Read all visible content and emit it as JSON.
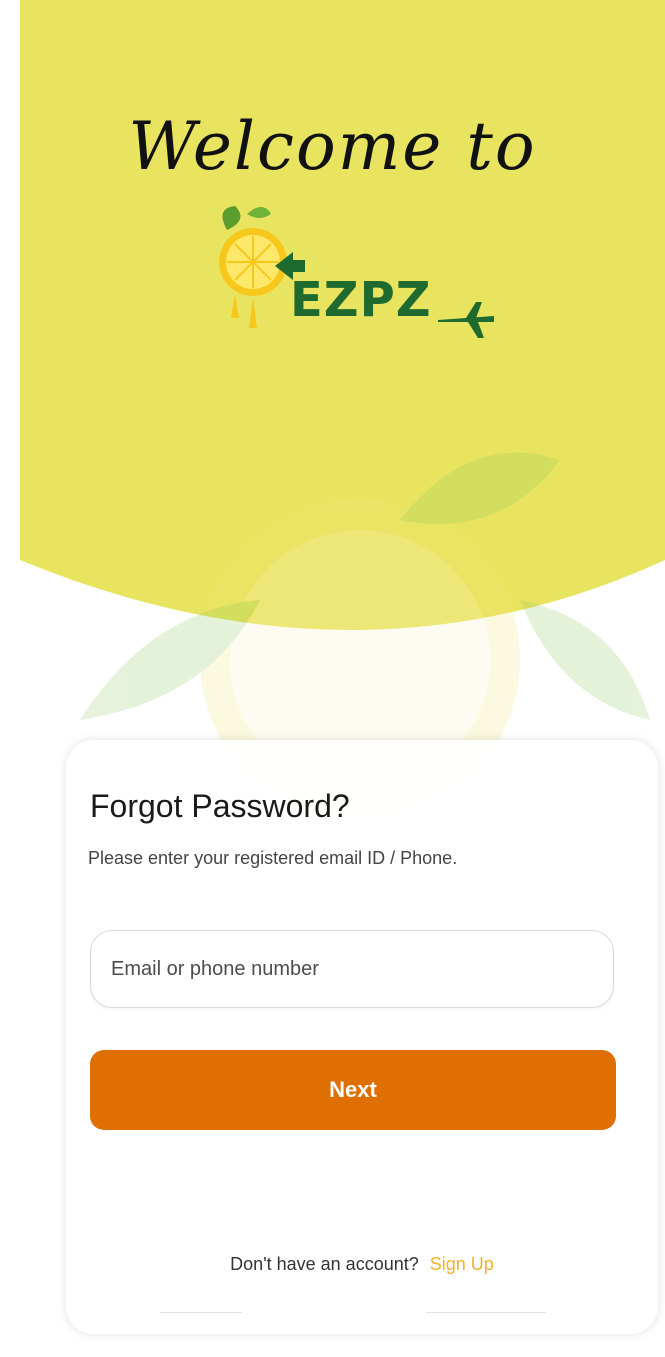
{
  "colors": {
    "top_background": "#e8e460",
    "accent_orange": "#df6f00",
    "link_yellow": "#f3b12a",
    "logo_green": "#1f6b2f",
    "card_background": "#ffffff"
  },
  "header": {
    "welcome_text": "Welcome to",
    "logo_text": "EZPZ"
  },
  "card": {
    "title": "Forgot Password?",
    "subtitle": "Please enter your registered email ID / Phone.",
    "input": {
      "placeholder": "Email or phone number",
      "value": ""
    },
    "next_label": "Next",
    "signup_prompt": "Don't have an account?",
    "signup_link": "Sign Up"
  },
  "icons": [
    "lemon-logo-icon",
    "airplane-icon"
  ]
}
